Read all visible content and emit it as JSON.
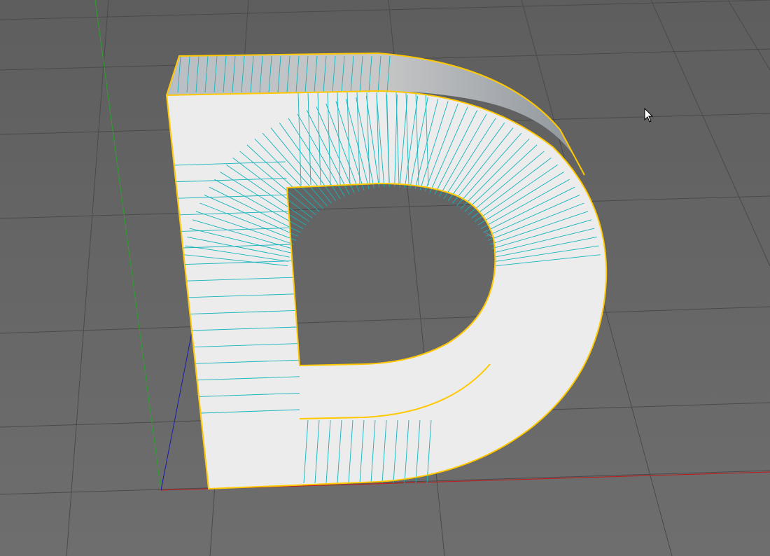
{
  "viewport": {
    "background_top": "#5e5e5e",
    "background_bottom": "#6e6e6e",
    "grid_color": "#4a4a4a",
    "axis_x_color": "#c21a1a",
    "axis_y_color": "#2aa12a",
    "axis_z_color": "#1a1aa8"
  },
  "object": {
    "shape": "extruded letter D",
    "face_color": "#ececec",
    "side_color": "#c0c0c0",
    "outline_color": "#ffc800",
    "wire_color": "#14b4bc",
    "selected": true
  },
  "cursor": {
    "icon": "arrow-cursor-icon"
  }
}
